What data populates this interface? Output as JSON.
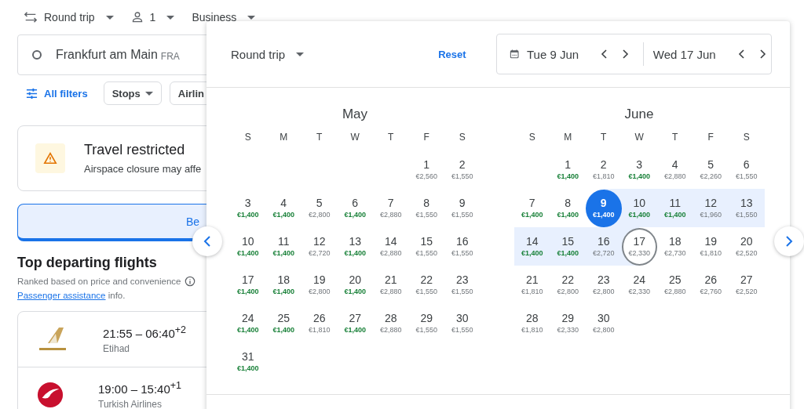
{
  "top_bar": {
    "trip_type": "Round trip",
    "passengers": "1",
    "cabin": "Business"
  },
  "origin": {
    "city": "Frankfurt am Main",
    "code": "FRA"
  },
  "filters": {
    "all_filters": "All filters",
    "chips": [
      "Stops",
      "Airlin"
    ]
  },
  "alert": {
    "title": "Travel restricted",
    "text": "Airspace closure may affe"
  },
  "sort_tab": {
    "label": "Be",
    "selected": true
  },
  "results": {
    "heading": "Top departing flights",
    "subtitle": "Ranked based on price and convenience",
    "link": "Passenger assistance",
    "link_suffix": " info.",
    "flights": [
      {
        "times": "21:55 – 06:40$^{+2}$",
        "airline": "Etihad",
        "kind": "etihad"
      },
      {
        "times": "19:00 – 15:40$^{+1}$",
        "airline": "Turkish Airlines",
        "kind": "turkish"
      }
    ]
  },
  "picker": {
    "trip_type": "Round trip",
    "reset": "Reset",
    "departure": "Tue 9 Jun",
    "return": "Wed 17 Jun",
    "months": [
      {
        "name": "May",
        "weekdays": [
          "S",
          "M",
          "T",
          "W",
          "T",
          "F",
          "S"
        ],
        "weeks": [
          [
            {
              "day": "1",
              "price": "€2,560",
              "cheap": false,
              "selected": false,
              "in_range": false,
              "outlined": false
            },
            {
              "day": "2",
              "price": "€1,550",
              "cheap": false,
              "selected": false,
              "in_range": false,
              "outlined": false
            }
          ],
          [
            {
              "day": "3",
              "price": "€1,400",
              "cheap": true,
              "selected": false,
              "in_range": false,
              "outlined": false
            },
            {
              "day": "4",
              "price": "€1,400",
              "cheap": true,
              "selected": false,
              "in_range": false,
              "outlined": false
            },
            {
              "day": "5",
              "price": "€2,800",
              "cheap": false,
              "selected": false,
              "in_range": false,
              "outlined": false
            },
            {
              "day": "6",
              "price": "€1,400",
              "cheap": true,
              "selected": false,
              "in_range": false,
              "outlined": false
            },
            {
              "day": "7",
              "price": "€2,880",
              "cheap": false,
              "selected": false,
              "in_range": false,
              "outlined": false
            },
            {
              "day": "8",
              "price": "€1,550",
              "cheap": false,
              "selected": false,
              "in_range": false,
              "outlined": false
            },
            {
              "day": "9",
              "price": "€1,550",
              "cheap": false,
              "selected": false,
              "in_range": false,
              "outlined": false
            }
          ],
          [
            {
              "day": "10",
              "price": "€1,400",
              "cheap": true,
              "selected": false,
              "in_range": false,
              "outlined": false
            },
            {
              "day": "11",
              "price": "€1,400",
              "cheap": true,
              "selected": false,
              "in_range": false,
              "outlined": false
            },
            {
              "day": "12",
              "price": "€2,720",
              "cheap": false,
              "selected": false,
              "in_range": false,
              "outlined": false
            },
            {
              "day": "13",
              "price": "€1,400",
              "cheap": true,
              "selected": false,
              "in_range": false,
              "outlined": false
            },
            {
              "day": "14",
              "price": "€2,880",
              "cheap": false,
              "selected": false,
              "in_range": false,
              "outlined": false
            },
            {
              "day": "15",
              "price": "€1,550",
              "cheap": false,
              "selected": false,
              "in_range": false,
              "outlined": false
            },
            {
              "day": "16",
              "price": "€1,550",
              "cheap": false,
              "selected": false,
              "in_range": false,
              "outlined": false
            }
          ],
          [
            {
              "day": "17",
              "price": "€1,400",
              "cheap": true,
              "selected": false,
              "in_range": false,
              "outlined": false
            },
            {
              "day": "18",
              "price": "€1,400",
              "cheap": true,
              "selected": false,
              "in_range": false,
              "outlined": false
            },
            {
              "day": "19",
              "price": "€2,800",
              "cheap": false,
              "selected": false,
              "in_range": false,
              "outlined": false
            },
            {
              "day": "20",
              "price": "€1,400",
              "cheap": true,
              "selected": false,
              "in_range": false,
              "outlined": false
            },
            {
              "day": "21",
              "price": "€2,880",
              "cheap": false,
              "selected": false,
              "in_range": false,
              "outlined": false
            },
            {
              "day": "22",
              "price": "€1,550",
              "cheap": false,
              "selected": false,
              "in_range": false,
              "outlined": false
            },
            {
              "day": "23",
              "price": "€1,550",
              "cheap": false,
              "selected": false,
              "in_range": false,
              "outlined": false
            }
          ],
          [
            {
              "day": "24",
              "price": "€1,400",
              "cheap": true,
              "selected": false,
              "in_range": false,
              "outlined": false
            },
            {
              "day": "25",
              "price": "€1,400",
              "cheap": true,
              "selected": false,
              "in_range": false,
              "outlined": false
            },
            {
              "day": "26",
              "price": "€1,810",
              "cheap": false,
              "selected": false,
              "in_range": false,
              "outlined": false
            },
            {
              "day": "27",
              "price": "€1,400",
              "cheap": true,
              "selected": false,
              "in_range": false,
              "outlined": false
            },
            {
              "day": "28",
              "price": "€2,880",
              "cheap": false,
              "selected": false,
              "in_range": false,
              "outlined": false
            },
            {
              "day": "29",
              "price": "€1,550",
              "cheap": false,
              "selected": false,
              "in_range": false,
              "outlined": false
            },
            {
              "day": "30",
              "price": "€1,550",
              "cheap": false,
              "selected": false,
              "in_range": false,
              "outlined": false
            }
          ],
          [
            {
              "day": "31",
              "price": "€1,400",
              "cheap": true,
              "selected": false,
              "in_range": false,
              "outlined": false
            }
          ]
        ]
      },
      {
        "name": "June",
        "weekdays": [
          "S",
          "M",
          "T",
          "W",
          "T",
          "F",
          "S"
        ],
        "weeks": [
          [
            {
              "day": "1",
              "price": "€1,400",
              "cheap": true,
              "selected": false,
              "in_range": false,
              "outlined": false
            },
            {
              "day": "2",
              "price": "€1,810",
              "cheap": false,
              "selected": false,
              "in_range": false,
              "outlined": false
            },
            {
              "day": "3",
              "price": "€1,400",
              "cheap": true,
              "selected": false,
              "in_range": false,
              "outlined": false
            },
            {
              "day": "4",
              "price": "€2,880",
              "cheap": false,
              "selected": false,
              "in_range": false,
              "outlined": false
            },
            {
              "day": "5",
              "price": "€2,260",
              "cheap": false,
              "selected": false,
              "in_range": false,
              "outlined": false
            },
            {
              "day": "6",
              "price": "€1,550",
              "cheap": false,
              "selected": false,
              "in_range": false,
              "outlined": false
            }
          ],
          [
            {
              "day": "7",
              "price": "€1,400",
              "cheap": true,
              "selected": false,
              "in_range": false,
              "outlined": false
            },
            {
              "day": "8",
              "price": "€1,400",
              "cheap": true,
              "selected": false,
              "in_range": false,
              "outlined": false
            },
            {
              "day": "9",
              "price": "€1,400",
              "cheap": true,
              "selected": true,
              "in_range": false,
              "outlined": false
            },
            {
              "day": "10",
              "price": "€1,400",
              "cheap": true,
              "selected": false,
              "in_range": true,
              "outlined": false
            },
            {
              "day": "11",
              "price": "€1,400",
              "cheap": true,
              "selected": false,
              "in_range": true,
              "outlined": false
            },
            {
              "day": "12",
              "price": "€1,960",
              "cheap": false,
              "selected": false,
              "in_range": true,
              "outlined": false
            },
            {
              "day": "13",
              "price": "€1,550",
              "cheap": false,
              "selected": false,
              "in_range": true,
              "outlined": false
            }
          ],
          [
            {
              "day": "14",
              "price": "€1,400",
              "cheap": true,
              "selected": false,
              "in_range": true,
              "outlined": false
            },
            {
              "day": "15",
              "price": "€1,400",
              "cheap": true,
              "selected": false,
              "in_range": true,
              "outlined": false
            },
            {
              "day": "16",
              "price": "€2,720",
              "cheap": false,
              "selected": false,
              "in_range": true,
              "outlined": false
            },
            {
              "day": "17",
              "price": "€2,330",
              "cheap": false,
              "selected": false,
              "in_range": false,
              "outlined": true
            },
            {
              "day": "18",
              "price": "€2,730",
              "cheap": false,
              "selected": false,
              "in_range": false,
              "outlined": false
            },
            {
              "day": "19",
              "price": "€1,810",
              "cheap": false,
              "selected": false,
              "in_range": false,
              "outlined": false
            },
            {
              "day": "20",
              "price": "€2,520",
              "cheap": false,
              "selected": false,
              "in_range": false,
              "outlined": false
            }
          ],
          [
            {
              "day": "21",
              "price": "€1,810",
              "cheap": false,
              "selected": false,
              "in_range": false,
              "outlined": false
            },
            {
              "day": "22",
              "price": "€2,800",
              "cheap": false,
              "selected": false,
              "in_range": false,
              "outlined": false
            },
            {
              "day": "23",
              "price": "€2,800",
              "cheap": false,
              "selected": false,
              "in_range": false,
              "outlined": false
            },
            {
              "day": "24",
              "price": "€2,330",
              "cheap": false,
              "selected": false,
              "in_range": false,
              "outlined": false
            },
            {
              "day": "25",
              "price": "€2,880",
              "cheap": false,
              "selected": false,
              "in_range": false,
              "outlined": false
            },
            {
              "day": "26",
              "price": "€2,760",
              "cheap": false,
              "selected": false,
              "in_range": false,
              "outlined": false
            },
            {
              "day": "27",
              "price": "€2,520",
              "cheap": false,
              "selected": false,
              "in_range": false,
              "outlined": false
            }
          ],
          [
            {
              "day": "28",
              "price": "€1,810",
              "cheap": false,
              "selected": false,
              "in_range": false,
              "outlined": false
            },
            {
              "day": "29",
              "price": "€2,330",
              "cheap": false,
              "selected": false,
              "in_range": false,
              "outlined": false
            },
            {
              "day": "30",
              "price": "€2,800",
              "cheap": false,
              "selected": false,
              "in_range": false,
              "outlined": false
            }
          ]
        ]
      }
    ]
  }
}
